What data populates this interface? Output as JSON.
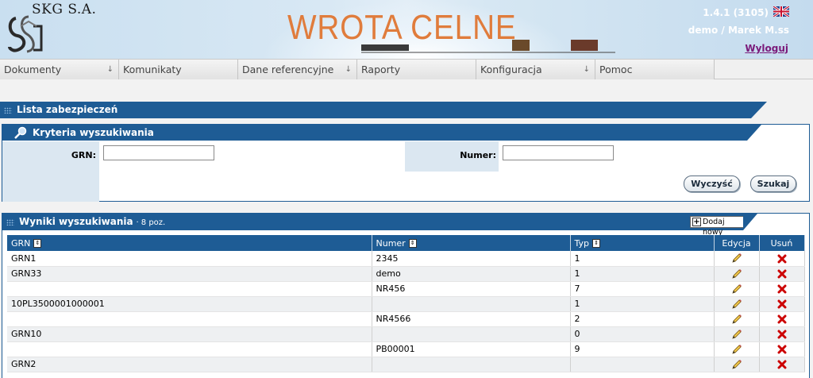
{
  "header": {
    "company": "SKG S.A.",
    "app_title": "WROTA CELNE",
    "version": "1.4.1 (3105)",
    "user": "demo / Marek M.ss",
    "logout": "Wyloguj",
    "language_flag": "uk-flag-icon"
  },
  "menu": [
    {
      "label": "Dokumenty",
      "arrow": "↓"
    },
    {
      "label": "Komunikaty",
      "arrow": ""
    },
    {
      "label": "Dane referencyjne",
      "arrow": "↓"
    },
    {
      "label": "Raporty",
      "arrow": ""
    },
    {
      "label": "Konfiguracja",
      "arrow": "↓"
    },
    {
      "label": "Pomoc",
      "arrow": ""
    }
  ],
  "page_title": "Lista zabezpieczeń",
  "criteria": {
    "title": "Kryteria wyszukiwania",
    "grn_label": "GRN:",
    "grn_value": "",
    "numer_label": "Numer:",
    "numer_value": "",
    "clear_button": "Wyczyść",
    "search_button": "Szukaj"
  },
  "results": {
    "title": "Wyniki wyszukiwania",
    "count": "· 8 poz.",
    "add_button": "Dodaj nowy",
    "columns": [
      "GRN",
      "Numer",
      "Typ",
      "Edycja",
      "Usuń"
    ],
    "rows": [
      {
        "grn": "GRN1",
        "numer": "2345",
        "typ": "1"
      },
      {
        "grn": "GRN33",
        "numer": "demo",
        "typ": "1"
      },
      {
        "grn": "",
        "numer": "NR456",
        "typ": "7"
      },
      {
        "grn": "10PL3500001000001",
        "numer": "",
        "typ": "1"
      },
      {
        "grn": "",
        "numer": "NR4566",
        "typ": "2"
      },
      {
        "grn": "GRN10",
        "numer": "",
        "typ": "0"
      },
      {
        "grn": "",
        "numer": "PB00001",
        "typ": "9"
      },
      {
        "grn": "GRN2",
        "numer": "",
        "typ": ""
      }
    ]
  },
  "colors": {
    "panel_blue": "#1e5c95",
    "title_orange": "#e07c3c",
    "delete_red": "#cc0000"
  }
}
